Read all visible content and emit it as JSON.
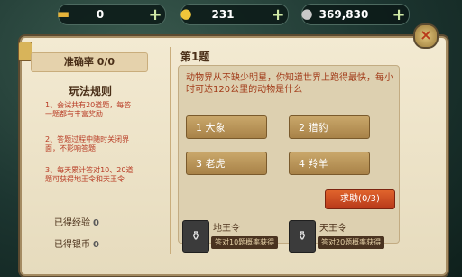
{
  "currency": [
    {
      "icon": "gold-ingot-icon",
      "glyph": "▬",
      "amount": "0",
      "color": "#e6b43a"
    },
    {
      "icon": "gold-coin-icon",
      "glyph": "●",
      "amount": "231",
      "color": "#f0c63a"
    },
    {
      "icon": "silver-coin-icon",
      "glyph": "●",
      "amount": "369,830",
      "color": "#c9c9c9"
    }
  ],
  "plus": "+",
  "close_glyph": "×",
  "accuracy": "准确率 0/0",
  "rules": {
    "title": "玩法规则",
    "items": [
      "1、会试共有20道题，每答一题都有丰富奖励",
      "2、答题过程中随时关闭界面，不影响答题",
      "3、每天累计答对10、20道题可获得地王令和天王令"
    ]
  },
  "stats": {
    "exp_label": "已得经验",
    "exp_value": "0",
    "silver_label": "已得银币",
    "silver_value": "0"
  },
  "question": {
    "number": "第1题",
    "text": "动物界从不缺少明星，你知道世界上跑得最快，每小时可达120公里的动物是什么",
    "options": [
      "1  大象",
      "2  猎豹",
      "3  老虎",
      "4  羚羊"
    ]
  },
  "help_button": "求助(0/3)",
  "rewards": [
    {
      "name": "地王令",
      "desc": "答对10题概率获得"
    },
    {
      "name": "天王令",
      "desc": "答对20题概率获得"
    }
  ]
}
